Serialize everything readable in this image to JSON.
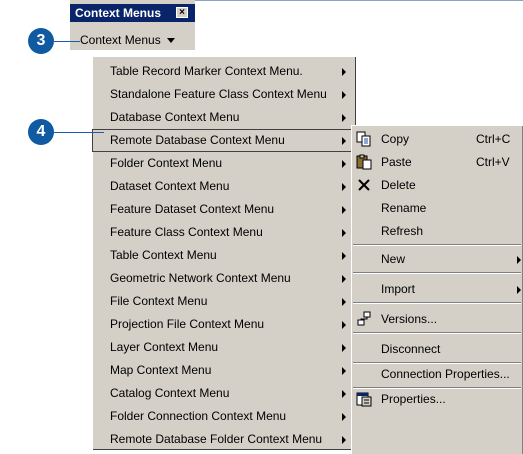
{
  "toolbar": {
    "title": "Context Menus",
    "close_glyph": "×",
    "button_label": "Context Menus"
  },
  "callouts": {
    "step3": "3",
    "step4": "4"
  },
  "menu": {
    "items": [
      {
        "label": "Table Record Marker Context Menu."
      },
      {
        "label": "Standalone Feature Class Context Menu"
      },
      {
        "label": "Database Context Menu"
      },
      {
        "label": "Remote Database Context Menu",
        "selected": true
      },
      {
        "label": "Folder Context Menu"
      },
      {
        "label": "Dataset Context Menu"
      },
      {
        "label": "Feature Dataset Context Menu"
      },
      {
        "label": "Feature Class Context Menu"
      },
      {
        "label": "Table Context Menu"
      },
      {
        "label": "Geometric Network Context Menu"
      },
      {
        "label": "File Context Menu"
      },
      {
        "label": "Projection File Context Menu"
      },
      {
        "label": "Layer Context Menu"
      },
      {
        "label": "Map Context Menu"
      },
      {
        "label": "Catalog Context Menu"
      },
      {
        "label": "Folder Connection Context Menu"
      },
      {
        "label": "Remote Database Folder Context Menu"
      }
    ]
  },
  "submenu": {
    "copy": {
      "label": "Copy",
      "shortcut": "Ctrl+C",
      "icon": "copy-icon"
    },
    "paste": {
      "label": "Paste",
      "shortcut": "Ctrl+V",
      "icon": "paste-icon"
    },
    "delete": {
      "label": "Delete",
      "icon": "delete-icon"
    },
    "rename": {
      "label": "Rename"
    },
    "refresh": {
      "label": "Refresh"
    },
    "new": {
      "label": "New"
    },
    "import": {
      "label": "Import"
    },
    "versions": {
      "label": "Versions...",
      "icon": "versions-icon"
    },
    "disconnect": {
      "label": "Disconnect"
    },
    "connection_properties": {
      "label": "Connection Properties..."
    },
    "properties": {
      "label": "Properties...",
      "icon": "properties-icon"
    }
  },
  "colors": {
    "menu_bg": "#d4d0c8",
    "title_bar": "#0a246a",
    "callout": "#0f5aa0"
  }
}
